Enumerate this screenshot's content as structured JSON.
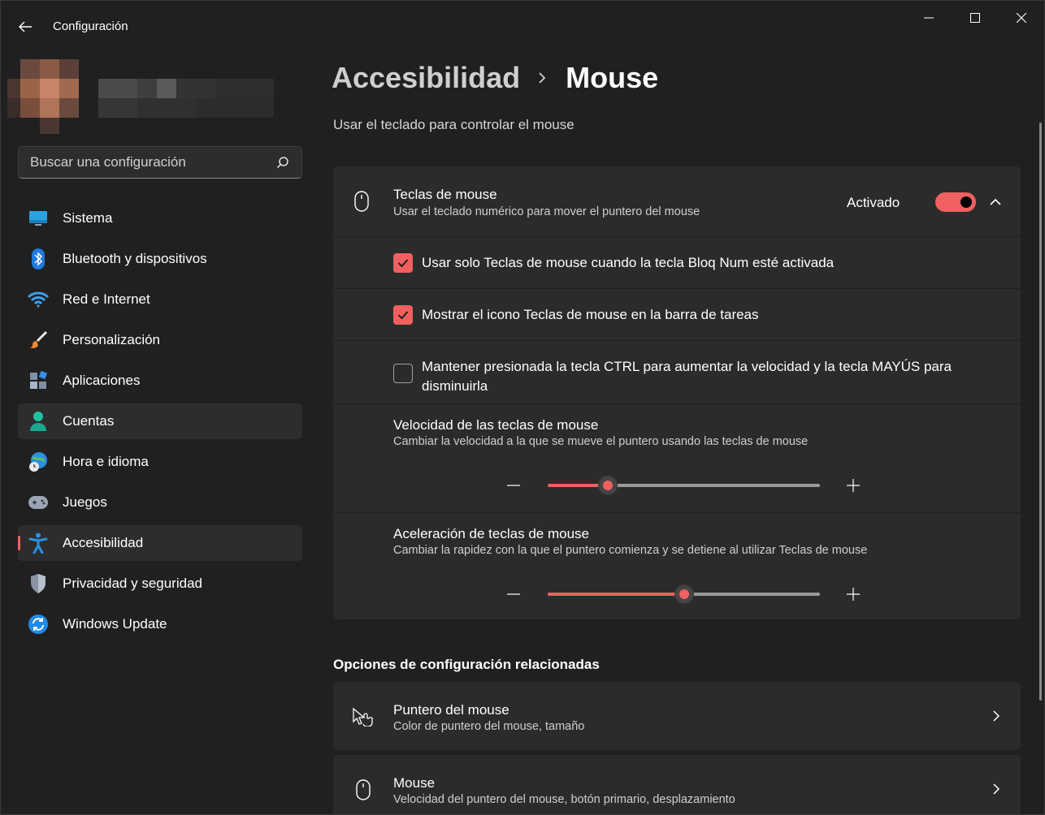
{
  "window": {
    "title": "Configuración"
  },
  "search": {
    "placeholder": "Buscar una configuración"
  },
  "sidebar": {
    "items": [
      {
        "label": "Sistema",
        "icon": "system-monitor-icon"
      },
      {
        "label": "Bluetooth y dispositivos",
        "icon": "bluetooth-icon"
      },
      {
        "label": "Red e Internet",
        "icon": "wifi-icon"
      },
      {
        "label": "Personalización",
        "icon": "paintbrush-icon"
      },
      {
        "label": "Aplicaciones",
        "icon": "apps-icon"
      },
      {
        "label": "Cuentas",
        "icon": "account-icon"
      },
      {
        "label": "Hora e idioma",
        "icon": "globe-clock-icon"
      },
      {
        "label": "Juegos",
        "icon": "gamepad-icon"
      },
      {
        "label": "Accesibilidad",
        "icon": "accessibility-icon"
      },
      {
        "label": "Privacidad y seguridad",
        "icon": "shield-icon"
      },
      {
        "label": "Windows Update",
        "icon": "update-icon"
      }
    ],
    "active": "Accesibilidad"
  },
  "breadcrumb": {
    "parent": "Accesibilidad",
    "current": "Mouse"
  },
  "page": {
    "subtitle": "Usar el teclado para controlar el mouse"
  },
  "mouse_keys": {
    "title": "Teclas de mouse",
    "description": "Usar el teclado numérico para mover el puntero del mouse",
    "toggle_label": "Activado",
    "toggle_on": true,
    "options": [
      {
        "label": "Usar solo Teclas de mouse cuando la tecla Bloq Num esté activada",
        "checked": true
      },
      {
        "label": "Mostrar el icono Teclas de mouse en la barra de tareas",
        "checked": true
      },
      {
        "label": "Mantener presionada la tecla CTRL para aumentar la velocidad y la tecla MAYÚS para disminuirla",
        "checked": false
      }
    ],
    "speed": {
      "title": "Velocidad de las teclas de mouse",
      "description": "Cambiar la velocidad a la que se mueve el puntero usando las teclas de mouse",
      "value_fraction": 0.22
    },
    "acceleration": {
      "title": "Aceleración de teclas de mouse",
      "description": "Cambiar la rapidez con la que el puntero comienza y se detiene al utilizar Teclas de mouse",
      "value_fraction": 0.5
    }
  },
  "related": {
    "title": "Opciones de configuración relacionadas",
    "items": [
      {
        "title": "Puntero del mouse",
        "description": "Color de puntero del mouse, tamaño",
        "icon": "mouse-pointer-icon"
      },
      {
        "title": "Mouse",
        "description": "Velocidad del puntero del mouse, botón primario, desplazamiento",
        "icon": "mouse-icon"
      }
    ]
  },
  "colors": {
    "accent": "#f06060",
    "background": "#202020",
    "card": "#2b2b2b"
  }
}
